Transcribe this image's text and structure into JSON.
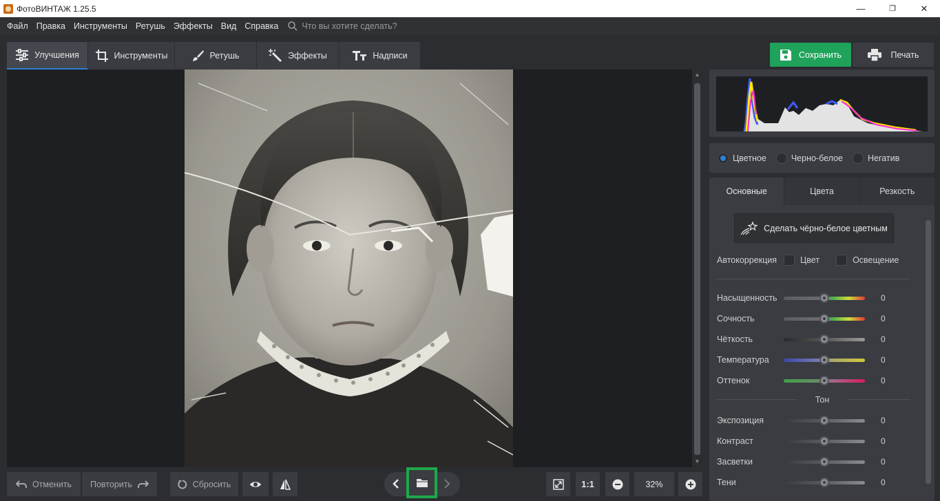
{
  "window": {
    "title": "ФотоВИНТАЖ 1.25.5",
    "minimize": "—",
    "restore": "❐",
    "close": "✕"
  },
  "menu": {
    "items": [
      "Файл",
      "Правка",
      "Инструменты",
      "Ретушь",
      "Эффекты",
      "Вид",
      "Справка"
    ],
    "search_placeholder": "Что вы хотите сделать?"
  },
  "tabs": [
    {
      "label": "Улучшения",
      "icon": "sliders-icon",
      "active": true
    },
    {
      "label": "Инструменты",
      "icon": "crop-icon",
      "active": false
    },
    {
      "label": "Ретушь",
      "icon": "brush-icon",
      "active": false
    },
    {
      "label": "Эффекты",
      "icon": "magic-wand-icon",
      "active": false
    },
    {
      "label": "Надписи",
      "icon": "text-icon",
      "active": false
    }
  ],
  "actions": {
    "save": "Сохранить",
    "print": "Печать"
  },
  "bottom": {
    "undo": "Отменить",
    "redo": "Повторить",
    "reset": "Сбросить",
    "one_to_one": "1:1",
    "zoom": "32%"
  },
  "panel": {
    "modes": [
      {
        "label": "Цветное",
        "selected": true
      },
      {
        "label": "Черно-белое",
        "selected": false
      },
      {
        "label": "Негатив",
        "selected": false
      }
    ],
    "subtabs": [
      "Основные",
      "Цвета",
      "Резкость"
    ],
    "colorize_button": "Сделать чёрно-белое цветным",
    "autocorrection": {
      "label": "Автокоррекция",
      "color": "Цвет",
      "lighting": "Освещение"
    },
    "sliders": [
      {
        "label": "Насыщенность",
        "value": "0",
        "gradient": "linear-gradient(90deg,#5a5c60 0%,#6a6c70 45%,#4caf50 60%,#cddc39 80%,#e53935 100%)"
      },
      {
        "label": "Сочность",
        "value": "0",
        "gradient": "linear-gradient(90deg,#5a5c60 0%,#6a6c70 45%,#4caf50 60%,#cddc39 80%,#e53935 100%)"
      },
      {
        "label": "Чёткость",
        "value": "0",
        "gradient": "linear-gradient(90deg,#2a2b2e 0%,#555 50%,#9a9a9a 100%)"
      },
      {
        "label": "Температура",
        "value": "0",
        "gradient": "linear-gradient(90deg,#3949ab 0%,#7a7cb0 45%,#a9a86a 60%,#d4c73a 100%)"
      },
      {
        "label": "Оттенок",
        "value": "0",
        "gradient": "linear-gradient(90deg,#43a047 0%,#6a8a6a 45%,#a06a8a 60%,#d81b60 100%)"
      }
    ],
    "tone_label": "Тон",
    "tone_sliders": [
      {
        "label": "Экспозиция",
        "value": "0",
        "gradient": "linear-gradient(90deg,#3a3b3e 0%,#5a5b5e 50%,#8a8b8e 100%)"
      },
      {
        "label": "Контраст",
        "value": "0",
        "gradient": "linear-gradient(90deg,#3a3b3e 0%,#5a5b5e 50%,#8a8b8e 100%)"
      },
      {
        "label": "Засветки",
        "value": "0",
        "gradient": "linear-gradient(90deg,#3a3b3e 0%,#5a5b5e 50%,#8a8b8e 100%)"
      },
      {
        "label": "Тени",
        "value": "0",
        "gradient": "linear-gradient(90deg,#3a3b3e 0%,#5a5b5e 50%,#8a8b8e 100%)"
      }
    ]
  },
  "colors": {
    "accent_blue": "#2f7fd6",
    "save_green": "#1fa25a",
    "highlight_green": "#1ea84a"
  }
}
